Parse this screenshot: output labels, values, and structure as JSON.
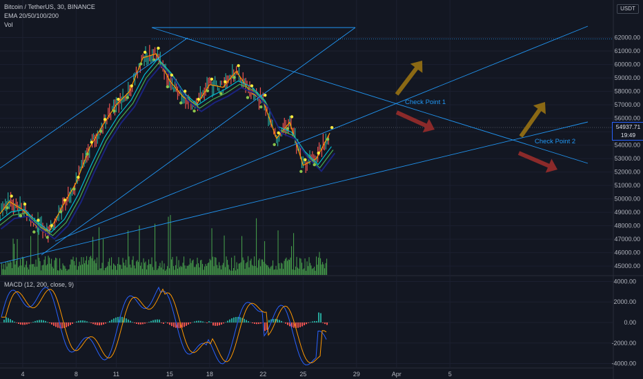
{
  "header": {
    "symbol_line": "Bitcoin / TetherUS, 30, BINANCE",
    "ema_label": "EMA 20/50/100/200",
    "vol_label": "Vol",
    "macd_label": "MACD (12, 200, close, 9)"
  },
  "currency": "USDT",
  "last_price": "54937.71",
  "countdown": "19:49",
  "annotations": {
    "check_point_1": "Check Point 1",
    "check_point_2": "Check Point 2"
  },
  "colors": {
    "background": "#131722",
    "trendline": "#2196f3",
    "arrow_up": "#8b6914",
    "arrow_down": "#8b2a2a",
    "volume": "#4caf50",
    "macd_line": "#2962ff",
    "signal_line": "#ff9800",
    "hist_pos": "#26a69a",
    "hist_neg": "#ef5350"
  },
  "chart_data": [
    {
      "type": "line",
      "title": "Bitcoin / TetherUS, 30, BINANCE",
      "x_ticks": [
        "4",
        "8",
        "11",
        "15",
        "18",
        "22",
        "25",
        "29",
        "Apr",
        "5"
      ],
      "y_ticks": [
        "62000.00",
        "61000.00",
        "60000.00",
        "59000.00",
        "58000.00",
        "57000.00",
        "56000.00",
        "55000.00",
        "54000.00",
        "53000.00",
        "52000.00",
        "51000.00",
        "50000.00",
        "49000.00",
        "48000.00",
        "47000.00",
        "46000.00",
        "45000.00"
      ],
      "ylim": [
        44700,
        62900
      ],
      "series": [
        {
          "x": [
            "Mar 2",
            "Mar 3",
            "Mar 4",
            "Mar 5",
            "Mar 6",
            "Mar 7",
            "Mar 8",
            "Mar 9",
            "Mar 10",
            "Mar 11",
            "Mar 12",
            "Mar 13",
            "Mar 14",
            "Mar 15",
            "Mar 16",
            "Mar 17",
            "Mar 18",
            "Mar 19",
            "Mar 20",
            "Mar 21",
            "Mar 22",
            "Mar 23",
            "Mar 24",
            "Mar 25",
            "Mar 26",
            "Mar 27"
          ],
          "values": [
            48500,
            49800,
            49200,
            48000,
            47600,
            49500,
            51200,
            53800,
            55500,
            57000,
            58000,
            60500,
            60800,
            58800,
            57600,
            57000,
            58500,
            58300,
            59500,
            58000,
            57300,
            54500,
            55700,
            52500,
            53000,
            54900
          ]
        }
      ]
    },
    {
      "type": "bar",
      "title": "Vol"
    },
    {
      "type": "line",
      "title": "MACD (12, 200, close, 9)",
      "y_ticks": [
        "4000.00",
        "2000.00",
        "0.00",
        "-2000.00",
        "-4000.00"
      ],
      "ylim": [
        -4300,
        4300
      ]
    }
  ]
}
